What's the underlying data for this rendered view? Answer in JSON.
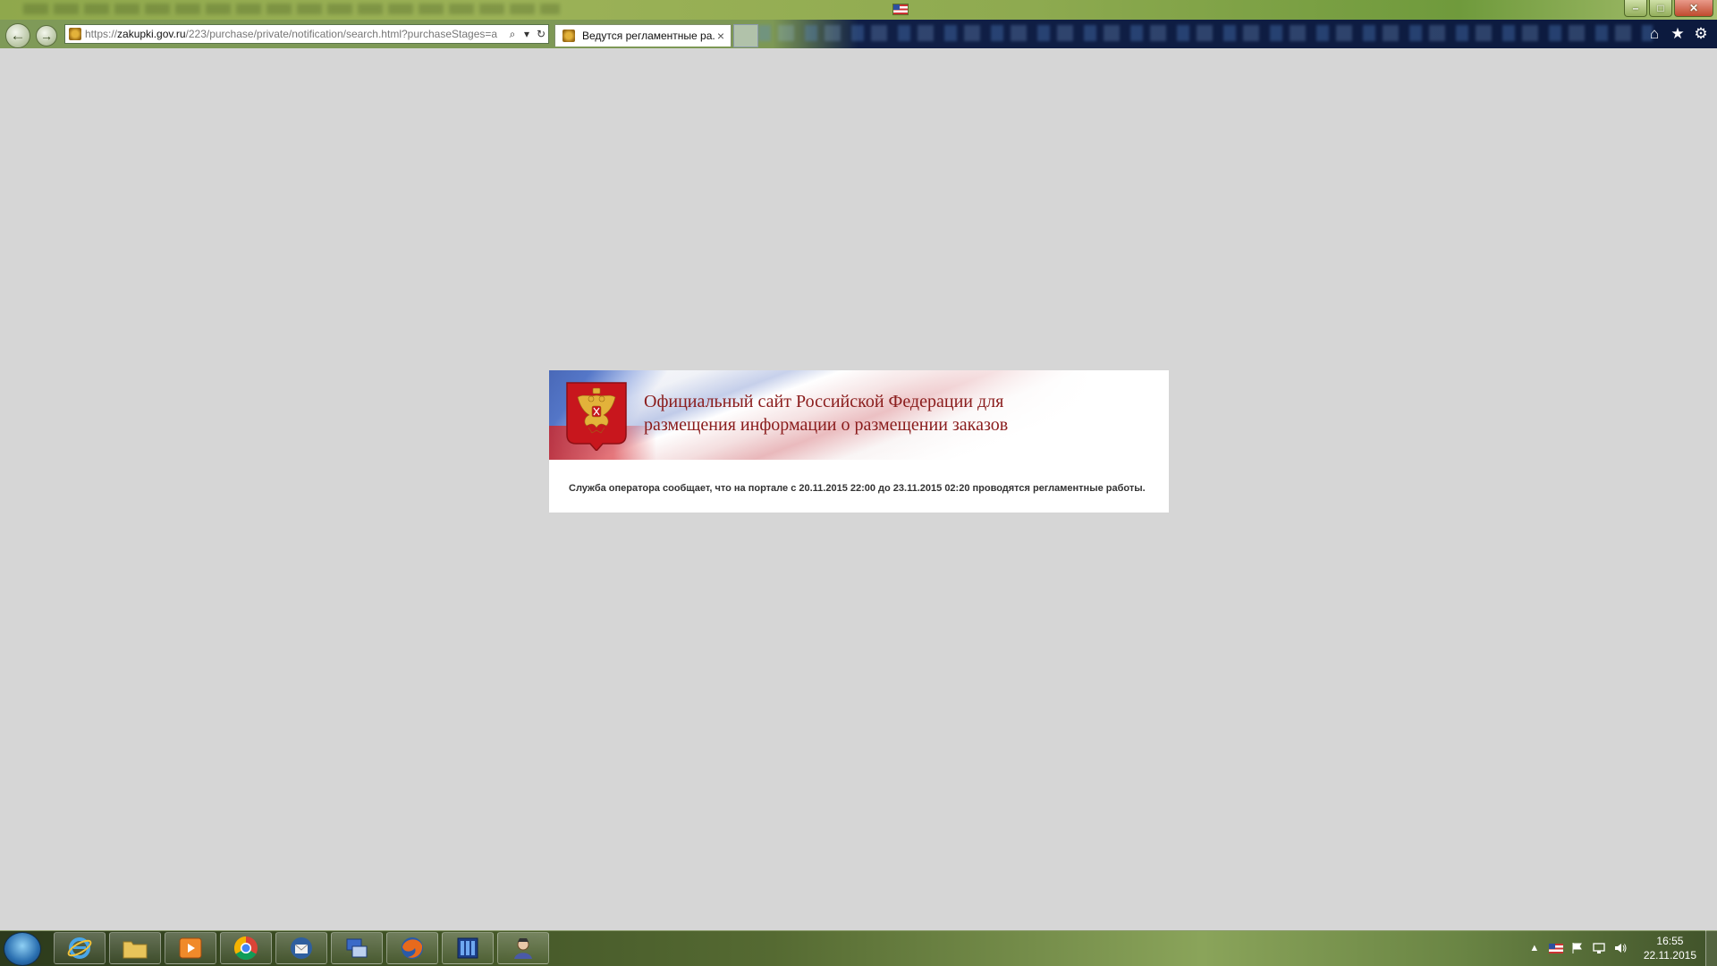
{
  "browser": {
    "address": {
      "scheme": "https://",
      "host": "zakupki.gov.ru",
      "path": "/223/purchase/private/notification/search.html?purchaseStages=a"
    },
    "tab": {
      "label": "Ведутся регламентные ра...",
      "close_glyph": "×"
    },
    "nav": {
      "back_glyph": "←",
      "forward_glyph": "→"
    },
    "address_icons": {
      "search_glyph": "⌕",
      "dropdown_glyph": "▾",
      "refresh_glyph": "↻"
    },
    "toolbar": {
      "home_glyph": "⌂",
      "favorites_glyph": "★",
      "settings_glyph": "⚙"
    },
    "window": {
      "minimize_glyph": "–",
      "maximize_glyph": "□",
      "close_glyph": "✕"
    }
  },
  "page": {
    "banner_title_line1": "Официальный сайт Российской Федерации для",
    "banner_title_line2": "размещения информации о размещении заказов",
    "notice": "Служба оператора сообщает, что на портале с 20.11.2015 22:00 до 23.11.2015 02:20 проводятся регламентные работы."
  },
  "taskbar": {
    "apps": [
      "start-orb",
      "internet-explorer-icon",
      "file-explorer-icon",
      "media-player-icon",
      "chrome-icon",
      "thunderbird-icon",
      "network-tool-icon",
      "firefox-icon",
      "calculator-app-icon",
      "user-app-icon"
    ],
    "tray": {
      "up_arrow_glyph": "▲",
      "time": "16:55",
      "date": "22.11.2015"
    }
  },
  "colors": {
    "banner_title": "#8a1c1c",
    "page_background": "#d6d6d6",
    "emblem_red": "#c8161d",
    "emblem_gold": "#e3b23a"
  }
}
